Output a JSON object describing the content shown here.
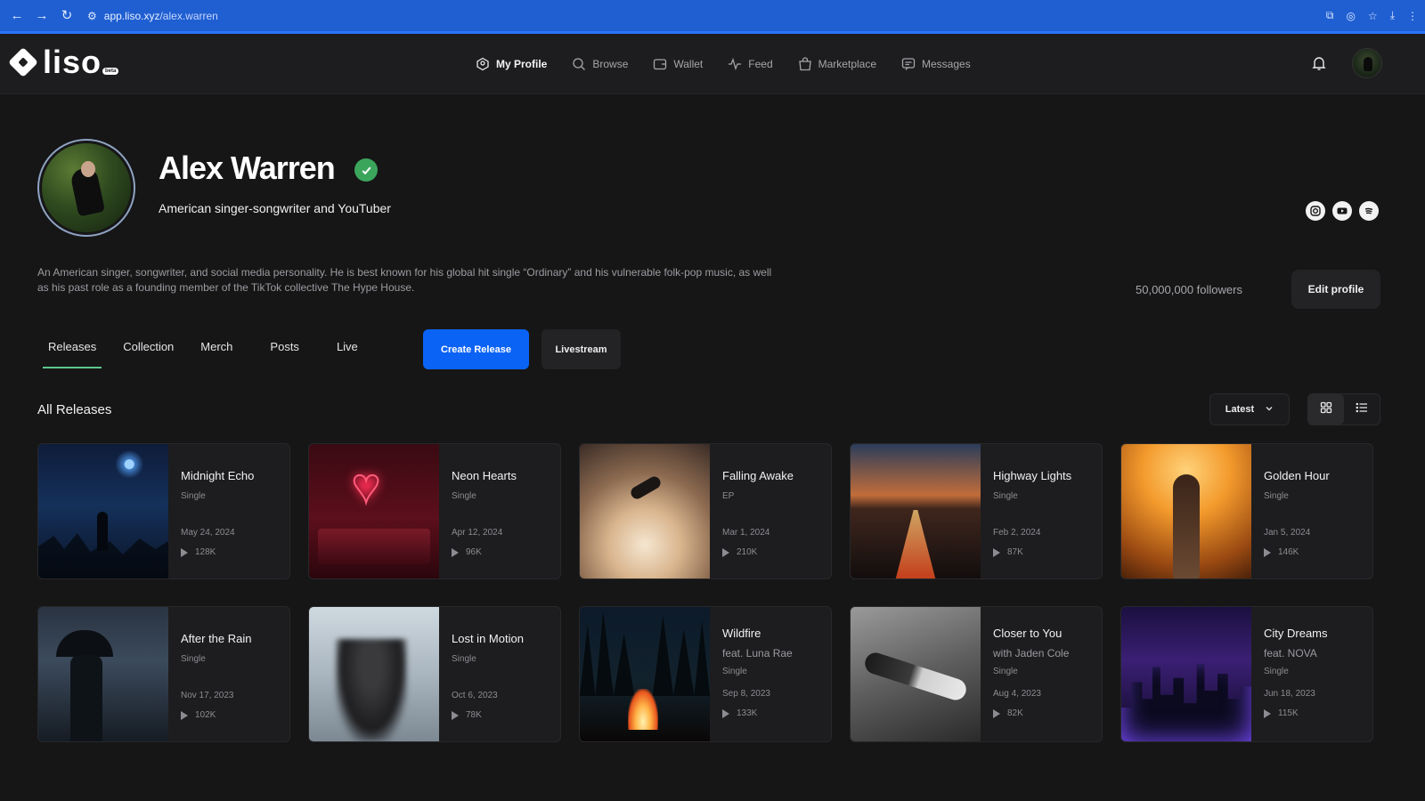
{
  "browser": {
    "url_host": "app.liso.xyz",
    "url_path": "/alex.warren"
  },
  "header": {
    "logo_text": "liso",
    "logo_badge": "beta",
    "nav": [
      {
        "label": "My Profile",
        "icon": "profile-icon",
        "active": true
      },
      {
        "label": "Browse",
        "icon": "search-icon",
        "active": false
      },
      {
        "label": "Wallet",
        "icon": "wallet-icon",
        "active": false
      },
      {
        "label": "Feed",
        "icon": "pulse-icon",
        "active": false
      },
      {
        "label": "Marketplace",
        "icon": "bag-icon",
        "active": false
      },
      {
        "label": "Messages",
        "icon": "message-icon",
        "active": false
      }
    ]
  },
  "profile": {
    "name": "Alex Warren",
    "tagline": "American singer-songwriter and YouTuber",
    "bio": "An American singer, songwriter, and social media personality. He is best known for his global hit single “Ordinary” and his vulnerable folk-pop music, as well as his past role as a founding member of the TikTok collective The Hype House.",
    "followers": "50,000,000 followers",
    "edit_label": "Edit profile",
    "socials": [
      "instagram-icon",
      "youtube-icon",
      "spotify-icon"
    ]
  },
  "tabs": [
    {
      "label": "Releases",
      "active": true
    },
    {
      "label": "Collection",
      "active": false
    },
    {
      "label": "Merch",
      "active": false
    },
    {
      "label": "Posts",
      "active": false
    },
    {
      "label": "Live",
      "active": false
    }
  ],
  "actions": {
    "create_release": "Create Release",
    "livestream": "Livestream"
  },
  "releases": {
    "title": "All Releases",
    "sort": "Latest",
    "items": [
      {
        "title": "Midnight Echo",
        "type": "Single",
        "date": "May 24, 2024",
        "plays": "128K"
      },
      {
        "title": "Neon Hearts",
        "type": "Single",
        "date": "Apr 12, 2024",
        "plays": "96K"
      },
      {
        "title": "Falling Awake",
        "type": "EP",
        "date": "Mar 1, 2024",
        "plays": "210K"
      },
      {
        "title": "Highway Lights",
        "type": "Single",
        "date": "Feb 2, 2024",
        "plays": "87K"
      },
      {
        "title": "Golden Hour",
        "type": "Single",
        "date": "Jan 5, 2024",
        "plays": "146K"
      },
      {
        "title": "After the Rain",
        "type": "Single",
        "date": "Nov 17, 2023",
        "plays": "102K"
      },
      {
        "title": "Lost in Motion",
        "type": "Single",
        "date": "Oct 6, 2023",
        "plays": "78K"
      },
      {
        "title": "Wildfire",
        "subtitle": "feat. Luna Rae",
        "type": "Single",
        "date": "Sep 8, 2023",
        "plays": "133K"
      },
      {
        "title": "Closer to You",
        "subtitle": "with Jaden Cole",
        "type": "Single",
        "date": "Aug 4, 2023",
        "plays": "82K"
      },
      {
        "title": "City Dreams",
        "subtitle": "feat. NOVA",
        "type": "Single",
        "date": "Jun 18, 2023",
        "plays": "115K"
      }
    ]
  }
}
